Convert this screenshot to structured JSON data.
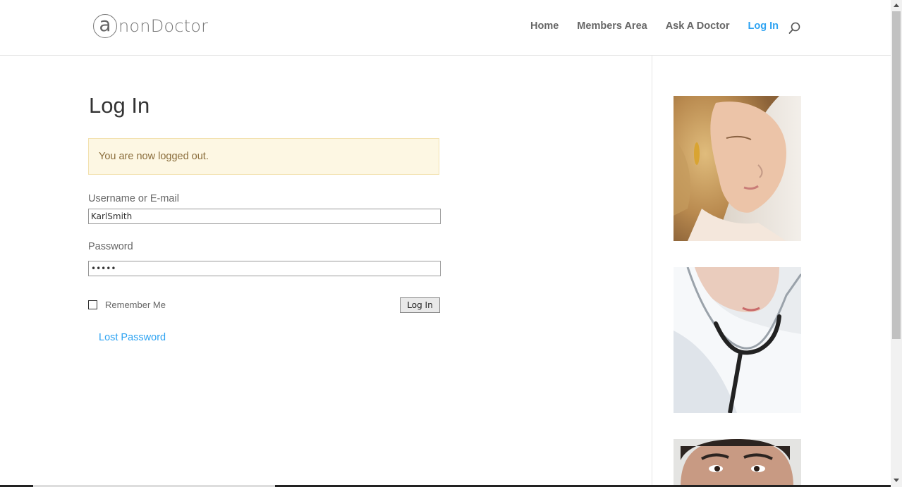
{
  "header": {
    "logo_mark": "a",
    "logo_text": "nonDoctor",
    "nav": [
      {
        "label": "Home"
      },
      {
        "label": "Members Area"
      },
      {
        "label": "Ask A Doctor"
      },
      {
        "label": "Log In",
        "active": true
      }
    ],
    "search_icon": "search-icon"
  },
  "main": {
    "title": "Log In",
    "notice": "You are now logged out.",
    "username_label": "Username or E-mail",
    "username_value": "KarlSmith",
    "password_label": "Password",
    "password_value": "•••••",
    "remember_label": "Remember Me",
    "login_button": "Log In",
    "lost_password": "Lost Password"
  },
  "colors": {
    "accent": "#2ea3f2",
    "notice_bg": "#fdf7e3",
    "notice_text": "#8a6d3b"
  }
}
